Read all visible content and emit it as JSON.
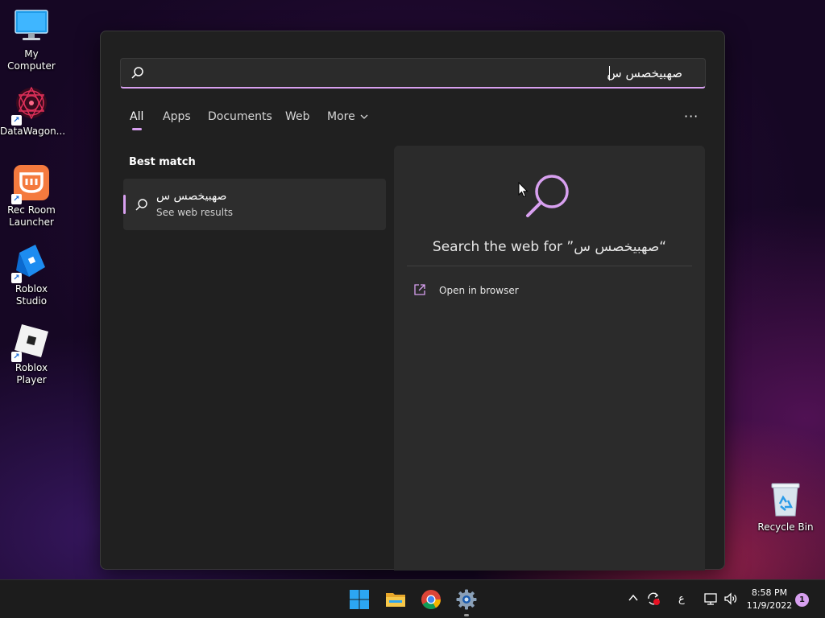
{
  "desktop": {
    "icons": [
      {
        "label": "My Computer",
        "icon": "monitor-icon"
      },
      {
        "label": "DataWagon...",
        "icon": "datawagon-icon"
      },
      {
        "label": "Rec Room Launcher",
        "icon": "rec-room-icon"
      },
      {
        "label": "Roblox Studio",
        "icon": "roblox-studio-icon"
      },
      {
        "label": "Roblox Player",
        "icon": "roblox-player-icon"
      },
      {
        "label": "Recycle Bin",
        "icon": "recycle-bin-icon"
      }
    ]
  },
  "search": {
    "query": "صهبيخصس س",
    "tabs": [
      "All",
      "Apps",
      "Documents",
      "Web",
      "More"
    ],
    "active_tab": "All",
    "more_options": "···",
    "best_match_title": "Best match",
    "best_match": {
      "title": "صهبيخصس س",
      "subtitle": "See web results"
    },
    "preview": {
      "title": "Search the web for ”صهبيخصس س“",
      "open_browser_label": "Open in browser"
    },
    "accent_color": "#d8a0f0"
  },
  "taskbar": {
    "apps": [
      "windows-start-icon",
      "file-explorer-icon",
      "chrome-icon",
      "settings-icon"
    ],
    "tray": {
      "language": "ع",
      "time": "8:58 PM",
      "date": "11/9/2022",
      "notifications": "1"
    }
  }
}
